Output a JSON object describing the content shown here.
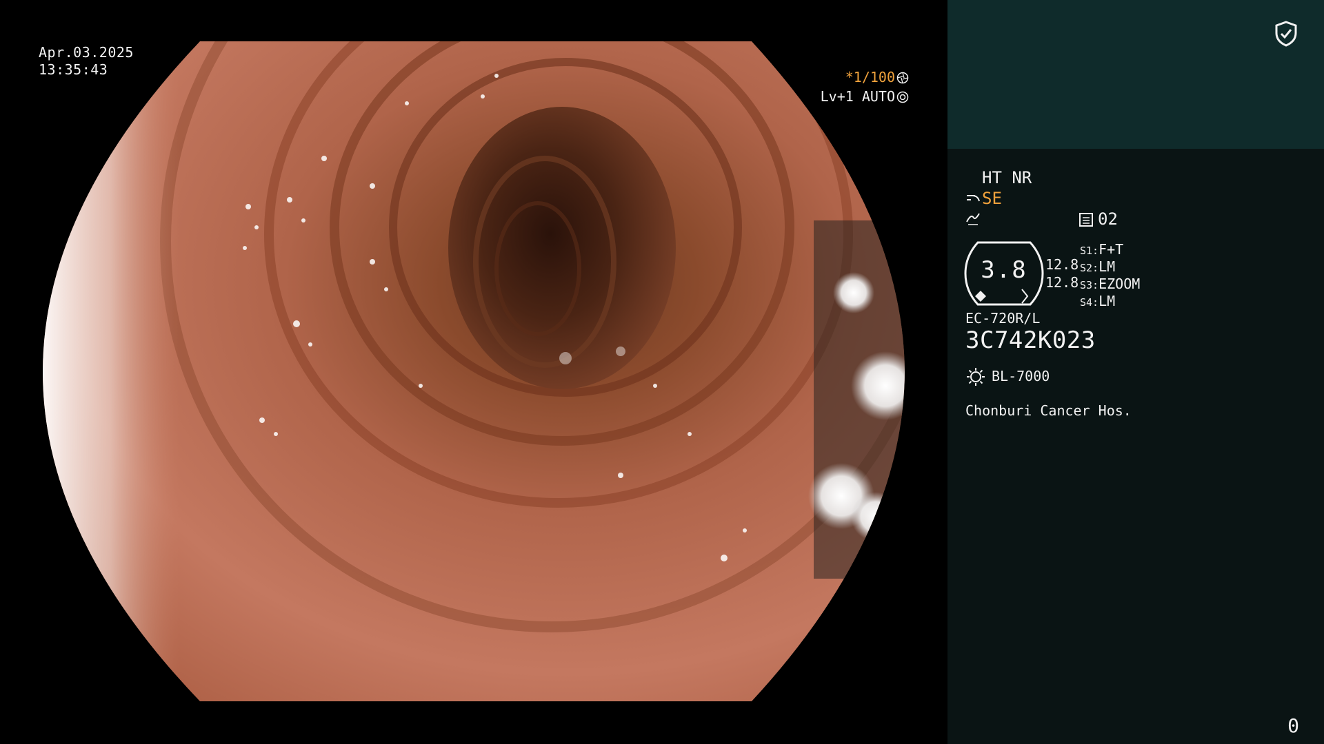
{
  "overlay": {
    "date": "Apr.03.2025",
    "time": "13:35:43",
    "shutter": "*1/100",
    "level_mode": "Lv+1 AUTO"
  },
  "panel": {
    "ht_nr": "HT NR",
    "se": "SE",
    "memory_code": "02",
    "gauge_value": "3.8",
    "val_a": "12.8",
    "val_b": "12.8",
    "switches": [
      {
        "key": "S1:",
        "value": "F+T"
      },
      {
        "key": "S2:",
        "value": "LM"
      },
      {
        "key": "S3:",
        "value": "EZOOM"
      },
      {
        "key": "S4:",
        "value": "LM"
      }
    ],
    "scope_model": "EC-720R/L",
    "serial": "3C742K023",
    "light_source": "BL-7000",
    "hospital": "Chonburi Cancer Hos.",
    "counter": "0"
  },
  "colors": {
    "accent_orange": "#f0a23c",
    "panel_top_bg": "#0f2b2b",
    "panel_bottom_bg": "#0a1414",
    "text": "#f2f2f2"
  },
  "icons": [
    "shield-check-icon",
    "aperture-icon",
    "iris-icon",
    "scope-tip-icon",
    "pulse-icon",
    "memory-icon",
    "light-source-icon"
  ]
}
